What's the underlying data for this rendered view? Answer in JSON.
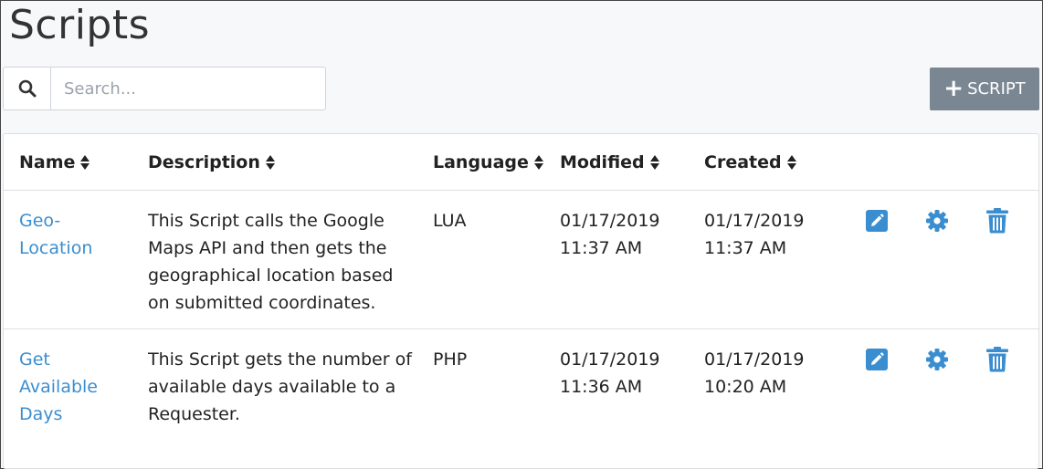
{
  "page": {
    "title": "Scripts"
  },
  "search": {
    "placeholder": "Search..."
  },
  "toolbar": {
    "add_label": "SCRIPT",
    "add_icon": "plus-icon"
  },
  "table": {
    "columns": [
      "Name",
      "Description",
      "Language",
      "Modified",
      "Created"
    ],
    "rows": [
      {
        "name_line1": "Geo-",
        "name_line2": "Location",
        "name_line3": "",
        "desc_line1": "This Script calls the Google",
        "desc_line2": "Maps API and then gets the",
        "desc_line3": "geographical location based",
        "desc_line4": "on submitted coordinates.",
        "language": "LUA",
        "modified_date": "01/17/2019",
        "modified_time": "11:37 AM",
        "created_date": "01/17/2019",
        "created_time": "11:37 AM"
      },
      {
        "name_line1": "Get",
        "name_line2": "Available",
        "name_line3": "Days",
        "desc_line1": "This Script gets the number of",
        "desc_line2": "available days available to a",
        "desc_line3": "Requester.",
        "desc_line4": "",
        "language": "PHP",
        "modified_date": "01/17/2019",
        "modified_time": "11:36 AM",
        "created_date": "01/17/2019",
        "created_time": "10:20 AM"
      }
    ],
    "actions": [
      "edit-icon",
      "gear-icon",
      "trash-icon"
    ]
  },
  "colors": {
    "accent": "#3a8ed0",
    "button": "#7a8692",
    "text": "#222222"
  }
}
